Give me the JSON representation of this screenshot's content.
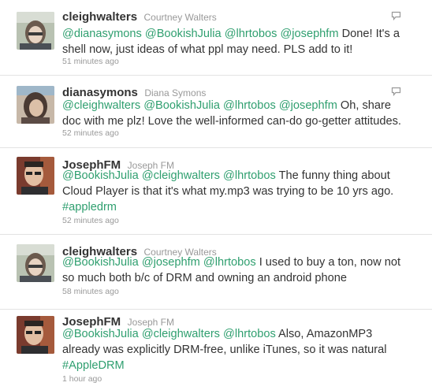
{
  "icons": {
    "reply": "speech-bubble-icon",
    "avatar": "user-photo-icon"
  },
  "colors": {
    "link": "#2f9f6f",
    "text": "#333333",
    "muted": "#999999",
    "divider": "#e3e3e3"
  },
  "tweets": [
    {
      "screen_name": "cleighwalters",
      "full_name": "Courtney Walters",
      "lines": [
        [
          {
            "t": "@dianasymons",
            "k": "mention"
          },
          {
            "t": " ",
            "k": "text"
          },
          {
            "t": "@BookishJulia",
            "k": "mention"
          },
          {
            "t": " ",
            "k": "text"
          },
          {
            "t": "@lhrtobos",
            "k": "mention"
          },
          {
            "t": " ",
            "k": "text"
          },
          {
            "t": "@josephfm",
            "k": "mention"
          },
          {
            "t": " Done! It's a",
            "k": "text"
          }
        ],
        [
          {
            "t": "shell now, just ideas of what ppl may need. PLS add to it!",
            "k": "text"
          }
        ]
      ],
      "time": "51 minutes ago"
    },
    {
      "screen_name": "dianasymons",
      "full_name": "Diana Symons",
      "lines": [
        [
          {
            "t": "@cleighwalters",
            "k": "mention"
          },
          {
            "t": " ",
            "k": "text"
          },
          {
            "t": "@BookishJulia",
            "k": "mention"
          },
          {
            "t": " ",
            "k": "text"
          },
          {
            "t": "@lhrtobos",
            "k": "mention"
          },
          {
            "t": " ",
            "k": "text"
          },
          {
            "t": "@josephfm",
            "k": "mention"
          },
          {
            "t": " Oh, share",
            "k": "text"
          }
        ],
        [
          {
            "t": "doc with me plz! Love the well-informed can-do go-getter attitudes.",
            "k": "text"
          }
        ]
      ],
      "time": "52 minutes ago"
    },
    {
      "screen_name": "JosephFM",
      "full_name": "Joseph FM",
      "lines": [
        [
          {
            "t": "@BookishJulia",
            "k": "mention"
          },
          {
            "t": " ",
            "k": "text"
          },
          {
            "t": "@cleighwalters",
            "k": "mention"
          },
          {
            "t": " ",
            "k": "text"
          },
          {
            "t": "@lhrtobos",
            "k": "mention"
          },
          {
            "t": " The funny thing about",
            "k": "text"
          }
        ],
        [
          {
            "t": "Cloud Player is that it's what my.mp3 was trying to be 10 yrs ago.",
            "k": "text"
          }
        ],
        [
          {
            "t": "#appledrm",
            "k": "hashtag"
          }
        ]
      ],
      "time": "52 minutes ago"
    },
    {
      "screen_name": "cleighwalters",
      "full_name": "Courtney Walters",
      "lines": [
        [
          {
            "t": "@BookishJulia",
            "k": "mention"
          },
          {
            "t": " ",
            "k": "text"
          },
          {
            "t": "@josephfm",
            "k": "mention"
          },
          {
            "t": " ",
            "k": "text"
          },
          {
            "t": "@lhrtobos",
            "k": "mention"
          },
          {
            "t": " I used to buy a ton, now not",
            "k": "text"
          }
        ],
        [
          {
            "t": "so much both b/c of DRM and owning an android phone",
            "k": "text"
          }
        ]
      ],
      "time": "58 minutes ago"
    },
    {
      "screen_name": "JosephFM",
      "full_name": "Joseph FM",
      "lines": [
        [
          {
            "t": "@BookishJulia",
            "k": "mention"
          },
          {
            "t": " ",
            "k": "text"
          },
          {
            "t": "@cleighwalters",
            "k": "mention"
          },
          {
            "t": " ",
            "k": "text"
          },
          {
            "t": "@lhrtobos",
            "k": "mention"
          },
          {
            "t": " Also, AmazonMP3",
            "k": "text"
          }
        ],
        [
          {
            "t": "already was explicitly DRM-free, unlike iTunes, so it was natural",
            "k": "text"
          }
        ],
        [
          {
            "t": "#AppleDRM",
            "k": "hashtag"
          }
        ]
      ],
      "time": "1 hour ago"
    }
  ]
}
